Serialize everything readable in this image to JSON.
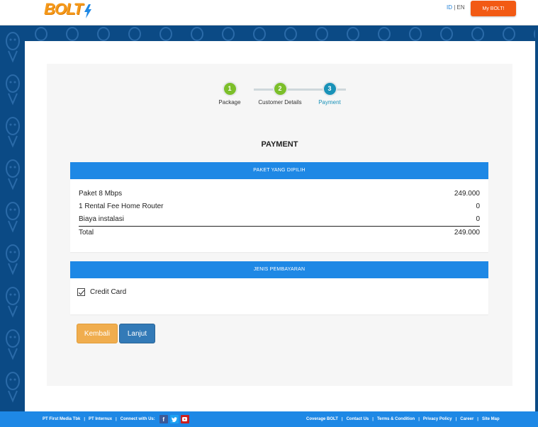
{
  "header": {
    "logo_text": "BOLT",
    "lang_id": "ID",
    "lang_sep": "|",
    "lang_en": "EN",
    "mybolt_label": "My BOLT!"
  },
  "stepper": {
    "steps": [
      {
        "number": "1",
        "label": "Package",
        "state": "done"
      },
      {
        "number": "2",
        "label": "Customer Details",
        "state": "done"
      },
      {
        "number": "3",
        "label": "Payment",
        "state": "current"
      }
    ]
  },
  "page_title": "PAYMENT",
  "package_card": {
    "header": "PAKET YANG DIPILIH",
    "rows": [
      {
        "label": "Paket 8 Mbps",
        "value": "249.000"
      },
      {
        "label": "1 Rental Fee Home Router",
        "value": "0"
      },
      {
        "label": "Biaya instalasi",
        "value": "0"
      }
    ],
    "total_label": "Total",
    "total_value": "249.000"
  },
  "payment_card": {
    "header": "JENIS PEMBAYARAN",
    "option_label": "Credit Card",
    "option_checked": true
  },
  "buttons": {
    "back_label": "Kembali",
    "next_label": "Lanjut"
  },
  "footer": {
    "company": "PT First Media Tbk",
    "internux": "PT Internux",
    "connect": "Connect with Us:",
    "links": [
      "Coverage BOLT",
      "Contact Us",
      "Terms & Condition",
      "Privacy Policy",
      "Career",
      "Site Map"
    ]
  },
  "colors": {
    "primary_blue": "#1e88e5",
    "accent_orange": "#f25a14",
    "step_done": "#7cbf2a",
    "step_current": "#1992b8",
    "back_button": "#f0ad4e",
    "next_button": "#337ab7"
  },
  "icons": [
    "bolt-logo-icon",
    "checkbox-checked-icon",
    "facebook-icon",
    "twitter-icon",
    "youtube-icon"
  ]
}
